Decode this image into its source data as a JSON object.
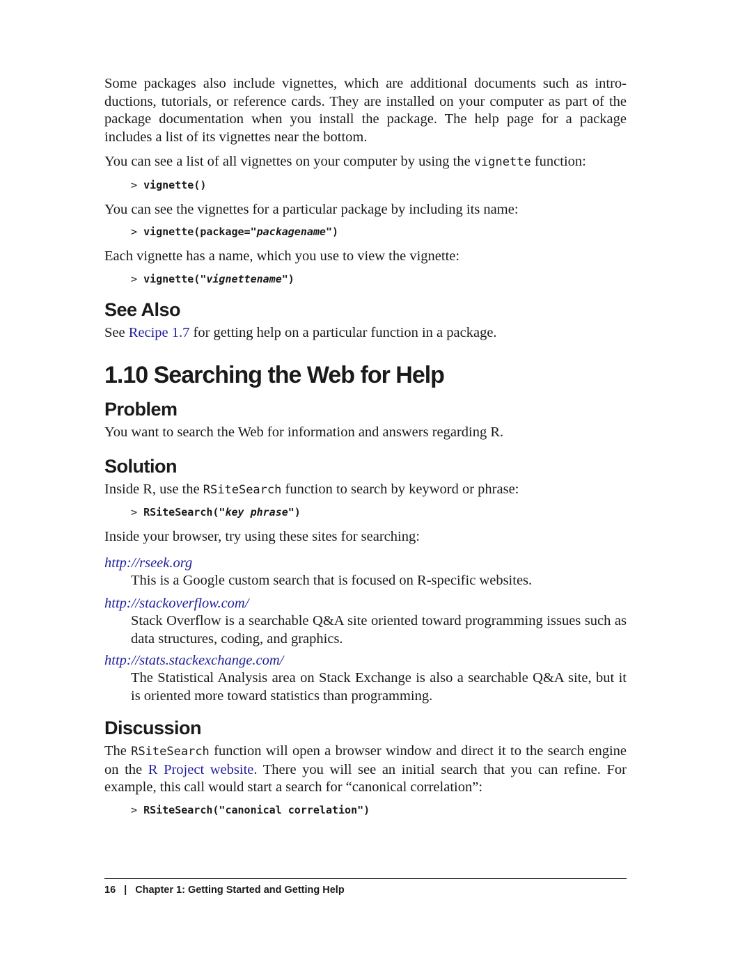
{
  "intro": {
    "p1": "Some packages also include vignettes, which are additional documents such as intro- ductions, tutorials, or reference cards. They are installed on your computer as part of the package documentation when you install the package. The help page for a package includes a list of its vignettes near the bottom.",
    "p2_pre": "You can see a list of all vignettes on your computer by using the ",
    "p2_code": "vignette",
    "p2_post": " function:",
    "code1_prompt": ">",
    "code1": "vignette()",
    "p3": "You can see the vignettes for a particular package by including its name:",
    "code2_prompt": ">",
    "code2_pre": "vignette(package=\"",
    "code2_it": "packagename",
    "code2_post": "\")",
    "p4": "Each vignette has a name, which you use to view the vignette:",
    "code3_prompt": ">",
    "code3_pre": "vignette(\"",
    "code3_it": "vignettename",
    "code3_post": "\")"
  },
  "see_also": {
    "heading": "See Also",
    "pre": "See ",
    "link": "Recipe 1.7",
    "post": " for getting help on a particular function in a package."
  },
  "section": {
    "title": "1.10  Searching the Web for Help",
    "problem_heading": "Problem",
    "problem_text": "You want to search the Web for information and answers regarding R.",
    "solution_heading": "Solution",
    "sol_pre": "Inside R, use the ",
    "sol_code": "RSiteSearch",
    "sol_post": " function to search by keyword or phrase:",
    "code4_prompt": ">",
    "code4_pre": "RSiteSearch(\"",
    "code4_it": "key phrase",
    "code4_post": "\")",
    "browser_text": "Inside your browser, try using these sites for searching:",
    "sites": [
      {
        "url": "http://rseek.org",
        "desc": "This is a Google custom search that is focused on R-specific websites."
      },
      {
        "url": "http://stackoverflow.com/",
        "desc": "Stack Overflow is a searchable Q&A site oriented toward programming issues such as data structures, coding, and graphics."
      },
      {
        "url": "http://stats.stackexchange.com/",
        "desc": "The Statistical Analysis area on Stack Exchange is also a searchable Q&A site, but it is oriented more toward statistics than programming."
      }
    ],
    "discussion_heading": "Discussion",
    "disc_pre": "The ",
    "disc_code": "RSiteSearch",
    "disc_mid": " function will open a browser window and direct it to the search engine on the ",
    "disc_link": "R Project website",
    "disc_post": ". There you will see an initial search that you can refine. For example, this call would start a search for “canonical correlation”:",
    "code5_prompt": ">",
    "code5": "RSiteSearch(\"canonical correlation\")"
  },
  "footer": {
    "page_number": "16",
    "separator": "|",
    "chapter": "Chapter 1:  Getting Started and Getting Help"
  }
}
